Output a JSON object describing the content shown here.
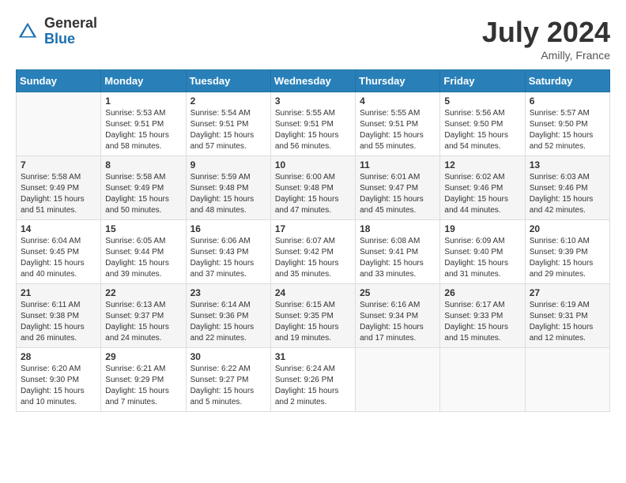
{
  "header": {
    "logo_general": "General",
    "logo_blue": "Blue",
    "month_year": "July 2024",
    "location": "Amilly, France"
  },
  "weekdays": [
    "Sunday",
    "Monday",
    "Tuesday",
    "Wednesday",
    "Thursday",
    "Friday",
    "Saturday"
  ],
  "weeks": [
    [
      {
        "day": "",
        "info": ""
      },
      {
        "day": "1",
        "info": "Sunrise: 5:53 AM\nSunset: 9:51 PM\nDaylight: 15 hours\nand 58 minutes."
      },
      {
        "day": "2",
        "info": "Sunrise: 5:54 AM\nSunset: 9:51 PM\nDaylight: 15 hours\nand 57 minutes."
      },
      {
        "day": "3",
        "info": "Sunrise: 5:55 AM\nSunset: 9:51 PM\nDaylight: 15 hours\nand 56 minutes."
      },
      {
        "day": "4",
        "info": "Sunrise: 5:55 AM\nSunset: 9:51 PM\nDaylight: 15 hours\nand 55 minutes."
      },
      {
        "day": "5",
        "info": "Sunrise: 5:56 AM\nSunset: 9:50 PM\nDaylight: 15 hours\nand 54 minutes."
      },
      {
        "day": "6",
        "info": "Sunrise: 5:57 AM\nSunset: 9:50 PM\nDaylight: 15 hours\nand 52 minutes."
      }
    ],
    [
      {
        "day": "7",
        "info": "Sunrise: 5:58 AM\nSunset: 9:49 PM\nDaylight: 15 hours\nand 51 minutes."
      },
      {
        "day": "8",
        "info": "Sunrise: 5:58 AM\nSunset: 9:49 PM\nDaylight: 15 hours\nand 50 minutes."
      },
      {
        "day": "9",
        "info": "Sunrise: 5:59 AM\nSunset: 9:48 PM\nDaylight: 15 hours\nand 48 minutes."
      },
      {
        "day": "10",
        "info": "Sunrise: 6:00 AM\nSunset: 9:48 PM\nDaylight: 15 hours\nand 47 minutes."
      },
      {
        "day": "11",
        "info": "Sunrise: 6:01 AM\nSunset: 9:47 PM\nDaylight: 15 hours\nand 45 minutes."
      },
      {
        "day": "12",
        "info": "Sunrise: 6:02 AM\nSunset: 9:46 PM\nDaylight: 15 hours\nand 44 minutes."
      },
      {
        "day": "13",
        "info": "Sunrise: 6:03 AM\nSunset: 9:46 PM\nDaylight: 15 hours\nand 42 minutes."
      }
    ],
    [
      {
        "day": "14",
        "info": "Sunrise: 6:04 AM\nSunset: 9:45 PM\nDaylight: 15 hours\nand 40 minutes."
      },
      {
        "day": "15",
        "info": "Sunrise: 6:05 AM\nSunset: 9:44 PM\nDaylight: 15 hours\nand 39 minutes."
      },
      {
        "day": "16",
        "info": "Sunrise: 6:06 AM\nSunset: 9:43 PM\nDaylight: 15 hours\nand 37 minutes."
      },
      {
        "day": "17",
        "info": "Sunrise: 6:07 AM\nSunset: 9:42 PM\nDaylight: 15 hours\nand 35 minutes."
      },
      {
        "day": "18",
        "info": "Sunrise: 6:08 AM\nSunset: 9:41 PM\nDaylight: 15 hours\nand 33 minutes."
      },
      {
        "day": "19",
        "info": "Sunrise: 6:09 AM\nSunset: 9:40 PM\nDaylight: 15 hours\nand 31 minutes."
      },
      {
        "day": "20",
        "info": "Sunrise: 6:10 AM\nSunset: 9:39 PM\nDaylight: 15 hours\nand 29 minutes."
      }
    ],
    [
      {
        "day": "21",
        "info": "Sunrise: 6:11 AM\nSunset: 9:38 PM\nDaylight: 15 hours\nand 26 minutes."
      },
      {
        "day": "22",
        "info": "Sunrise: 6:13 AM\nSunset: 9:37 PM\nDaylight: 15 hours\nand 24 minutes."
      },
      {
        "day": "23",
        "info": "Sunrise: 6:14 AM\nSunset: 9:36 PM\nDaylight: 15 hours\nand 22 minutes."
      },
      {
        "day": "24",
        "info": "Sunrise: 6:15 AM\nSunset: 9:35 PM\nDaylight: 15 hours\nand 19 minutes."
      },
      {
        "day": "25",
        "info": "Sunrise: 6:16 AM\nSunset: 9:34 PM\nDaylight: 15 hours\nand 17 minutes."
      },
      {
        "day": "26",
        "info": "Sunrise: 6:17 AM\nSunset: 9:33 PM\nDaylight: 15 hours\nand 15 minutes."
      },
      {
        "day": "27",
        "info": "Sunrise: 6:19 AM\nSunset: 9:31 PM\nDaylight: 15 hours\nand 12 minutes."
      }
    ],
    [
      {
        "day": "28",
        "info": "Sunrise: 6:20 AM\nSunset: 9:30 PM\nDaylight: 15 hours\nand 10 minutes."
      },
      {
        "day": "29",
        "info": "Sunrise: 6:21 AM\nSunset: 9:29 PM\nDaylight: 15 hours\nand 7 minutes."
      },
      {
        "day": "30",
        "info": "Sunrise: 6:22 AM\nSunset: 9:27 PM\nDaylight: 15 hours\nand 5 minutes."
      },
      {
        "day": "31",
        "info": "Sunrise: 6:24 AM\nSunset: 9:26 PM\nDaylight: 15 hours\nand 2 minutes."
      },
      {
        "day": "",
        "info": ""
      },
      {
        "day": "",
        "info": ""
      },
      {
        "day": "",
        "info": ""
      }
    ]
  ]
}
